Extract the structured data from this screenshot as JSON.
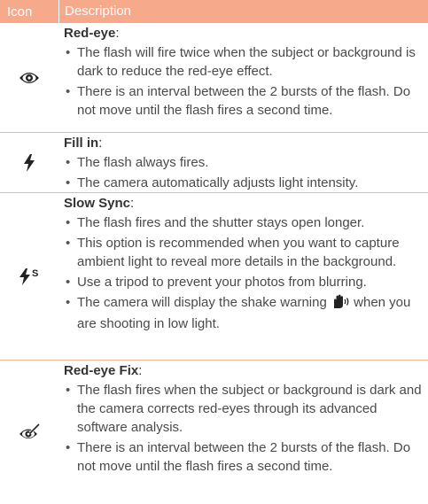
{
  "header": {
    "col_icon": "Icon",
    "col_description": "Description"
  },
  "rows": [
    {
      "icon": "red-eye-icon",
      "title": "Red-eye",
      "bullets": [
        "The flash will fire twice when the subject or background is dark to reduce the red-eye effect.",
        "There is an interval between the 2 bursts of the flash. Do not move until the flash fires a second time."
      ]
    },
    {
      "icon": "flash-fill-in-icon",
      "title": "Fill in",
      "bullets": [
        "The flash always fires.",
        "The camera automatically adjusts light intensity."
      ]
    },
    {
      "icon": "slow-sync-icon",
      "title": "Slow Sync",
      "bullets": [
        "The flash fires and the shutter stays open longer.",
        "This option is recommended when you want to capture ambient light to reveal more details in the background.",
        "Use a tripod to prevent your photos from blurring."
      ],
      "shake_warning_before": "The camera will display the shake warning",
      "shake_warning_after": "when you are shooting in low light."
    },
    {
      "icon": "red-eye-fix-icon",
      "title": "Red-eye Fix",
      "bullets": [
        "The flash fires when the subject or background is dark and the camera corrects red-eyes through its advanced software analysis.",
        "There is an interval between the 2 bursts of the flash. Do not move until the flash fires a second time."
      ]
    }
  ],
  "colors": {
    "header_bg": "#f6a98b",
    "divider": "#f2b59c",
    "text": "#4a4a4a"
  }
}
